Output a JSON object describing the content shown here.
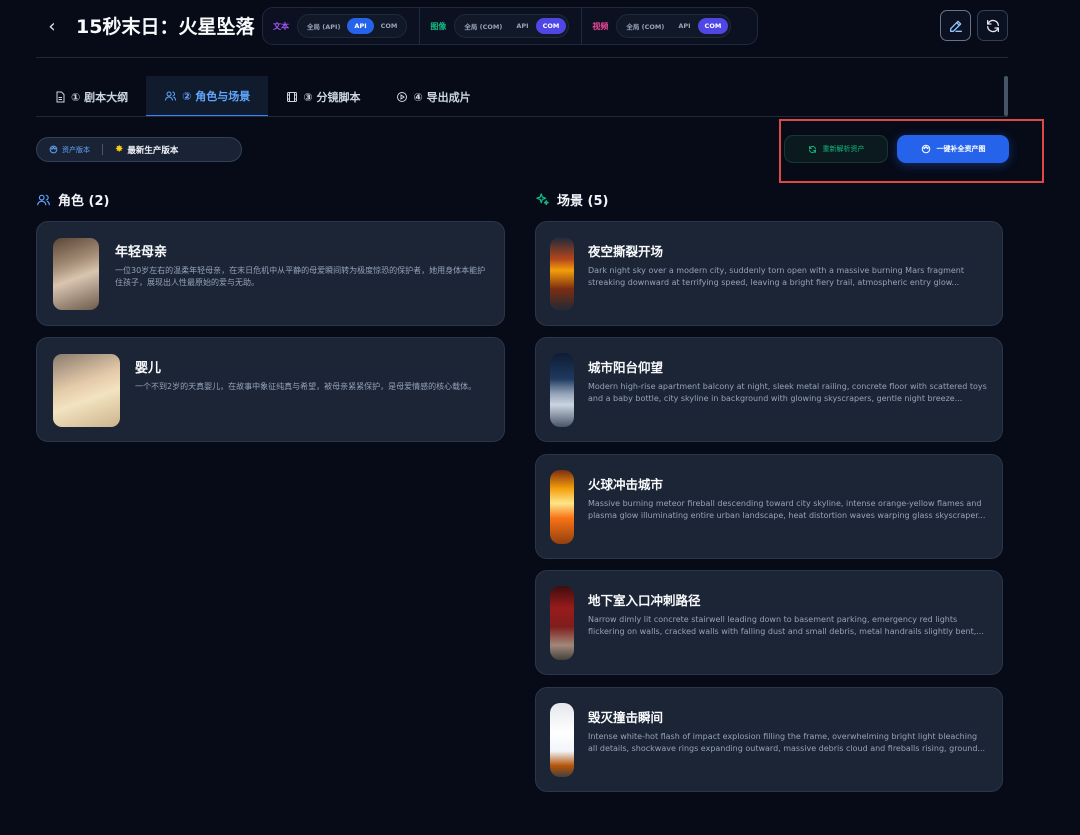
{
  "header": {
    "back_label": "‹",
    "title": "15秒末日：火星坠落",
    "modes": [
      {
        "label": "文本",
        "color": "#a855f7",
        "options": [
          "全局 (API)",
          "API",
          "COM"
        ],
        "selected": "API"
      },
      {
        "label": "图像",
        "color": "#10b981",
        "options": [
          "全局 (COM)",
          "API",
          "COM"
        ],
        "selected": "COM"
      },
      {
        "label": "视频",
        "color": "#ec4899",
        "options": [
          "全局 (COM)",
          "API",
          "COM"
        ],
        "selected": "COM"
      }
    ]
  },
  "tabs": [
    {
      "label": "① 剧本大纲",
      "icon": "document-icon"
    },
    {
      "label": "② 角色与场景",
      "icon": "users-icon",
      "active": true
    },
    {
      "label": "③ 分镜脚本",
      "icon": "film-icon"
    },
    {
      "label": "④ 导出成片",
      "icon": "play-circle-icon"
    }
  ],
  "version": {
    "asset_label": "资产版本",
    "current_label": "最新生产版本"
  },
  "actions": {
    "reparse_label": "重新解析资产",
    "fill_label": "一键补全资产图"
  },
  "characters": {
    "heading": "角色 (2)",
    "items": [
      {
        "name": "年轻母亲",
        "desc": "一位30岁左右的温柔年轻母亲，在末日危机中从平静的母爱瞬间转为极度惊恐的保护者，她用身体本能护住孩子，展现出人性最原始的爱与无助。"
      },
      {
        "name": "婴儿",
        "desc": "一个不到2岁的天真婴儿，在故事中象征纯真与希望，被母亲紧紧保护，是母爱情感的核心载体。"
      }
    ]
  },
  "scenes": {
    "heading": "场景 (5)",
    "items": [
      {
        "name": "夜空撕裂开场",
        "desc": "Dark night sky over a modern city, suddenly torn open with a massive burning Mars fragment streaking downward at terrifying speed, leaving a bright fiery trail, atmospheric entry glow..."
      },
      {
        "name": "城市阳台仰望",
        "desc": "Modern high-rise apartment balcony at night, sleek metal railing, concrete floor with scattered toys and a baby bottle, city skyline in background with glowing skyscrapers, gentle night breeze..."
      },
      {
        "name": "火球冲击城市",
        "desc": "Massive burning meteor fireball descending toward city skyline, intense orange-yellow flames and plasma glow illuminating entire urban landscape, heat distortion waves warping glass skyscraper..."
      },
      {
        "name": "地下室入口冲刺路径",
        "desc": "Narrow dimly lit concrete stairwell leading down to basement parking, emergency red lights flickering on walls, cracked walls with falling dust and small debris, metal handrails slightly bent,..."
      },
      {
        "name": "毁灭撞击瞬间",
        "desc": "Intense white-hot flash of impact explosion filling the frame, overwhelming bright light bleaching all details, shockwave rings expanding outward, massive debris cloud and fireballs rising, ground..."
      }
    ]
  }
}
